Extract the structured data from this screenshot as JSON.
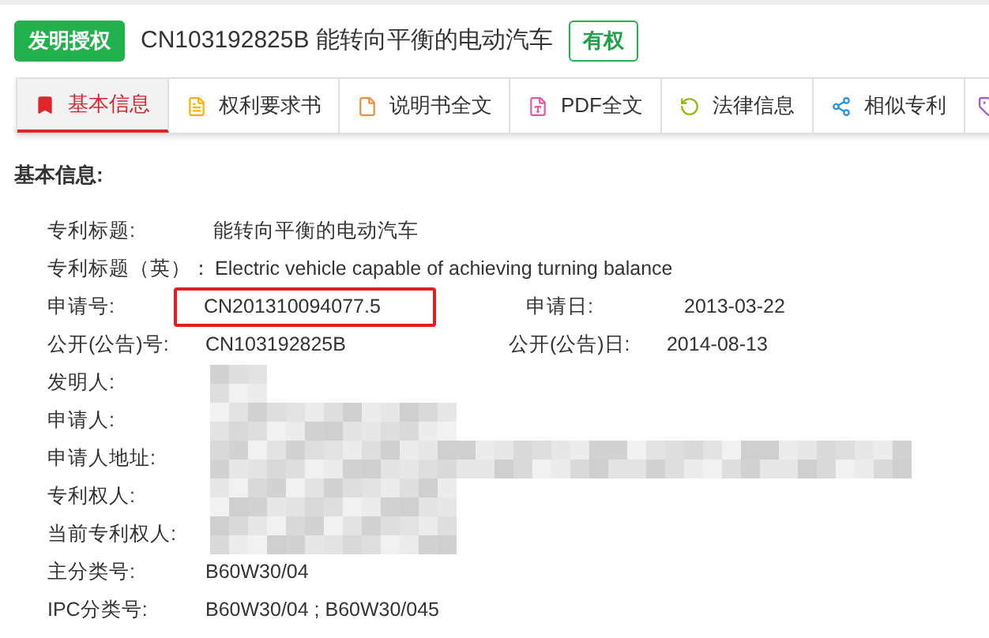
{
  "header": {
    "type_tag": "发明授权",
    "title": "CN103192825B 能转向平衡的电动汽车",
    "status": "有权"
  },
  "tabs": [
    {
      "label": "基本信息",
      "selected": true
    },
    {
      "label": "权利要求书",
      "selected": false
    },
    {
      "label": "说明书全文",
      "selected": false
    },
    {
      "label": "PDF全文",
      "selected": false
    },
    {
      "label": "法律信息",
      "selected": false
    },
    {
      "label": "相似专利",
      "selected": false
    }
  ],
  "section_title": "基本信息:",
  "fields": [
    {
      "label": "专利标题:",
      "value": "能转向平衡的电动汽车",
      "kind": "text",
      "highlighted": false
    },
    {
      "label": "专利标题（英）：",
      "value": "Electric vehicle capable of achieving turning balance",
      "kind": "text",
      "highlighted": false
    },
    {
      "label": "申请号:",
      "value": "CN201310094077.5",
      "kind": "text",
      "highlighted": true,
      "right_label": "申请日:",
      "right_value": "2013-03-22"
    },
    {
      "label": "公开(公告)号:",
      "value": "CN103192825B",
      "kind": "text",
      "highlighted": false,
      "right_label": "公开(公告)日:",
      "right_value": "2014-08-13"
    },
    {
      "label": "发明人:",
      "kind": "redacted"
    },
    {
      "label": "申请人:",
      "kind": "redacted"
    },
    {
      "label": "申请人地址:",
      "kind": "redacted"
    },
    {
      "label": "专利权人:",
      "kind": "redacted"
    },
    {
      "label": "当前专利权人:",
      "kind": "redacted"
    },
    {
      "label": "主分类号:",
      "value": "B60W30/04",
      "kind": "text",
      "highlighted": false
    },
    {
      "label": "IPC分类号:",
      "value": "B60W30/04 ; B60W30/045",
      "kind": "text",
      "highlighted": false
    }
  ]
}
